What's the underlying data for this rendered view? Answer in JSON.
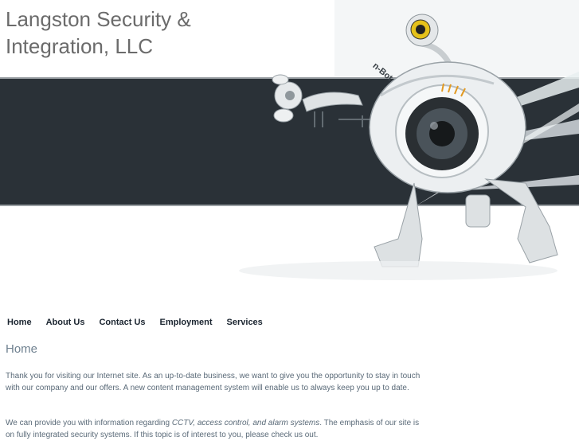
{
  "site": {
    "title_line1": "Langston Security &",
    "title_line2": "Integration, LLC",
    "robot_badge_text": "n-Bot"
  },
  "nav": {
    "items": [
      {
        "label": "Home"
      },
      {
        "label": "About Us"
      },
      {
        "label": "Contact Us"
      },
      {
        "label": "Employment"
      },
      {
        "label": "Services"
      }
    ]
  },
  "main": {
    "heading": "Home",
    "paragraph1": "Thank you for visiting our Internet site. As an up-to-date business, we want to give you the opportunity to stay in touch with our company and our offers. A new content management system will enable us to always keep you up to date.",
    "paragraph2_start": "We can provide you with information regarding ",
    "paragraph2_emphasis": "CCTV, access control, and alarm systems",
    "paragraph2_rest": ". The emphasis of our site is on fully integrated security systems. If this topic is of interest to you, please check us out."
  },
  "colors": {
    "banner": "#2a3137",
    "title_text": "#6b6b6b",
    "nav_text": "#1b2530",
    "body_text": "#5a6a78"
  }
}
